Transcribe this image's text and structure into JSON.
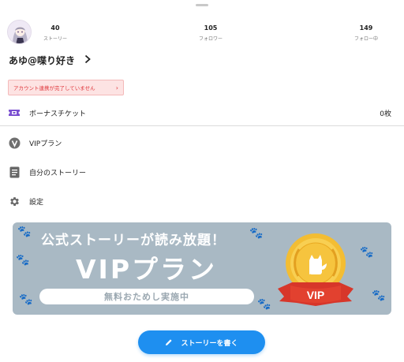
{
  "profile": {
    "username": "あゆ@喋り好き",
    "avatar_icon": "avatar-image"
  },
  "stats": [
    {
      "value": "40",
      "label": "ストーリー"
    },
    {
      "value": "105",
      "label": "フォロワー"
    },
    {
      "value": "149",
      "label": "フォロー中"
    }
  ],
  "warning": {
    "text": "アカウント連携が完了していません",
    "arrow": "›"
  },
  "menu": {
    "bonus_ticket": {
      "label": "ボーナスチケット",
      "value": "0枚",
      "icon": "ticket-icon"
    },
    "vip_plan": {
      "label": "VIPプラン",
      "icon": "vip-badge-icon"
    },
    "my_stories": {
      "label": "自分のストーリー",
      "icon": "document-icon"
    },
    "settings": {
      "label": "設定",
      "icon": "gear-icon"
    }
  },
  "banner": {
    "headline": "公式ストーリーが読み放題！",
    "title": "VIPプラン",
    "trial": "無料おためし実施中",
    "medal_label": "VIP"
  },
  "cta": {
    "label": "ストーリーを書く",
    "icon": "pencil-icon"
  },
  "colors": {
    "accent": "#1e8ff0",
    "warning_bg": "#fde3e3",
    "warning_text": "#e0393e",
    "banner_bg": "#a9b9c4",
    "vip_purple": "#7a4fd1",
    "medal_gold": "#f0b62a",
    "ribbon_red": "#d7362a"
  }
}
